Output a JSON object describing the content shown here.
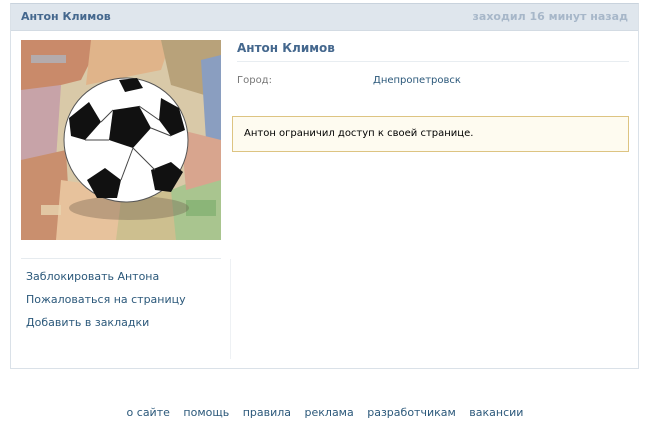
{
  "header": {
    "name": "Антон Климов",
    "last_seen": "заходил 16 минут назад"
  },
  "avatar": {
    "description_icon": "soccer-ball-on-euro-banknotes"
  },
  "actions": [
    "Заблокировать Антона",
    "Пожаловаться на страницу",
    "Добавить в закладки"
  ],
  "profile": {
    "name": "Антон Климов",
    "city_label": "Город:",
    "city_value": "Днепропетровск"
  },
  "notice": {
    "text": "Антон ограничил доступ к своей странице."
  },
  "footer": {
    "links": [
      "о сайте",
      "помощь",
      "правила",
      "реклама",
      "разработчикам",
      "вакансии"
    ]
  },
  "colors": {
    "link": "#2b587a",
    "header_bg": "#dfe6ed",
    "name": "#45688e",
    "notice_bg": "#fefbf0",
    "notice_border": "#ddc482"
  }
}
